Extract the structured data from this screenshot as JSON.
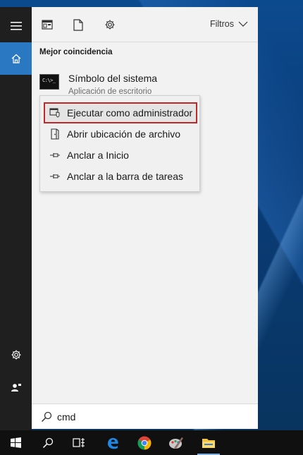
{
  "toolbar": {
    "filters_label": "Filtros"
  },
  "results": {
    "section_title": "Mejor coincidencia",
    "best_match": {
      "name": "Símbolo del sistema",
      "subtitle": "Aplicación de escritorio",
      "icon_text": "C:\\>_"
    }
  },
  "context_menu": {
    "items": [
      {
        "label": "Ejecutar como administrador",
        "icon": "run-as-admin-icon",
        "highlighted": true
      },
      {
        "label": "Abrir ubicación de archivo",
        "icon": "open-location-icon"
      },
      {
        "label": "Anclar a Inicio",
        "icon": "pin-icon"
      },
      {
        "label": "Anclar a la barra de tareas",
        "icon": "pin-icon"
      }
    ]
  },
  "search": {
    "value": "cmd"
  },
  "colors": {
    "accent": "#2b78c2",
    "highlight_border": "#c0282c",
    "rail_bg": "#1f1f1f",
    "taskbar_bg": "#101010"
  }
}
